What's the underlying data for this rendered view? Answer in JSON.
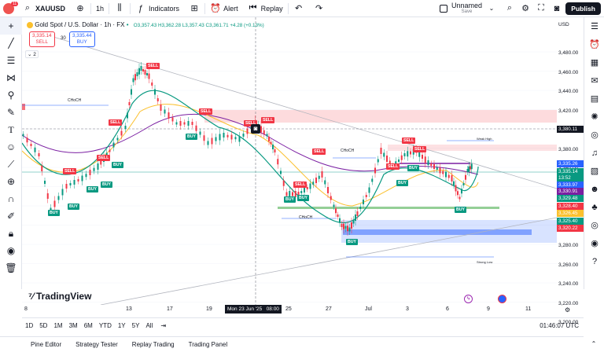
{
  "header": {
    "symbol": "XAUUSD",
    "interval": "1h",
    "indicators_label": "Indicators",
    "alert_label": "Alert",
    "replay_label": "Replay",
    "layout_name": "Unnamed",
    "layout_status": "Save",
    "publish_label": "Publish",
    "notification_badge": "11"
  },
  "legend": {
    "title": "Gold Spot / U.S. Dollar · 1h · FX",
    "ohlc": "O3,357.43 H3,362.28 L3,357.43 C3,361.71 +4.28 (+0.13%)",
    "sell_price": "3,335.14",
    "sell_label": "SELL",
    "spread": "30",
    "buy_price": "3,335.44",
    "buy_label": "BUY",
    "indicator_count": "2"
  },
  "price_axis": {
    "currency": "USD",
    "ticks": [
      "3,480.00",
      "3,460.00",
      "3,440.00",
      "3,420.00",
      "3,400.00",
      "3,380.00",
      "3,360.00",
      "3,340.00",
      "3,320.00",
      "3,300.00",
      "3,280.00",
      "3,260.00",
      "3,240.00",
      "3,220.00",
      "3,200.00"
    ],
    "labels": [
      {
        "text": "3,380.11",
        "color": "#131722"
      },
      {
        "text": "3,335.26",
        "color": "#2962ff"
      },
      {
        "text": "3,335.14",
        "color": "#089981"
      },
      {
        "text": "13:52",
        "color": "#089981"
      },
      {
        "text": "3,333.97",
        "color": "#2962ff"
      },
      {
        "text": "3,330.91",
        "color": "#7b1fa2"
      },
      {
        "text": "3,329.48",
        "color": "#089981"
      },
      {
        "text": "3,328.40",
        "color": "#f23645"
      },
      {
        "text": "3,326.45",
        "color": "#fbc02d"
      },
      {
        "text": "3,325.40",
        "color": "#089981"
      },
      {
        "text": "3,320.22",
        "color": "#f23645"
      }
    ]
  },
  "time_axis": {
    "ticks": [
      "8",
      "13",
      "17",
      "19",
      "25",
      "27",
      "Jul",
      "3",
      "6",
      "9",
      "11"
    ],
    "crosshair_label": "Mon 23 Jun '25   08:00"
  },
  "chart_labels": {
    "choch": "CHoCH",
    "weak_high": "Weak High",
    "strong_low": "Strong Low"
  },
  "range_bar": {
    "ranges": [
      "1D",
      "5D",
      "1M",
      "3M",
      "6M",
      "YTD",
      "1Y",
      "5Y",
      "All"
    ],
    "clock": "01:46:07 UTC"
  },
  "bottom_tabs": [
    "Pine Editor",
    "Strategy Tester",
    "Replay Trading",
    "Trading Panel"
  ],
  "brand": "TradingView",
  "colors": {
    "bull": "#089981",
    "bear": "#f23645",
    "accent": "#2962ff"
  }
}
